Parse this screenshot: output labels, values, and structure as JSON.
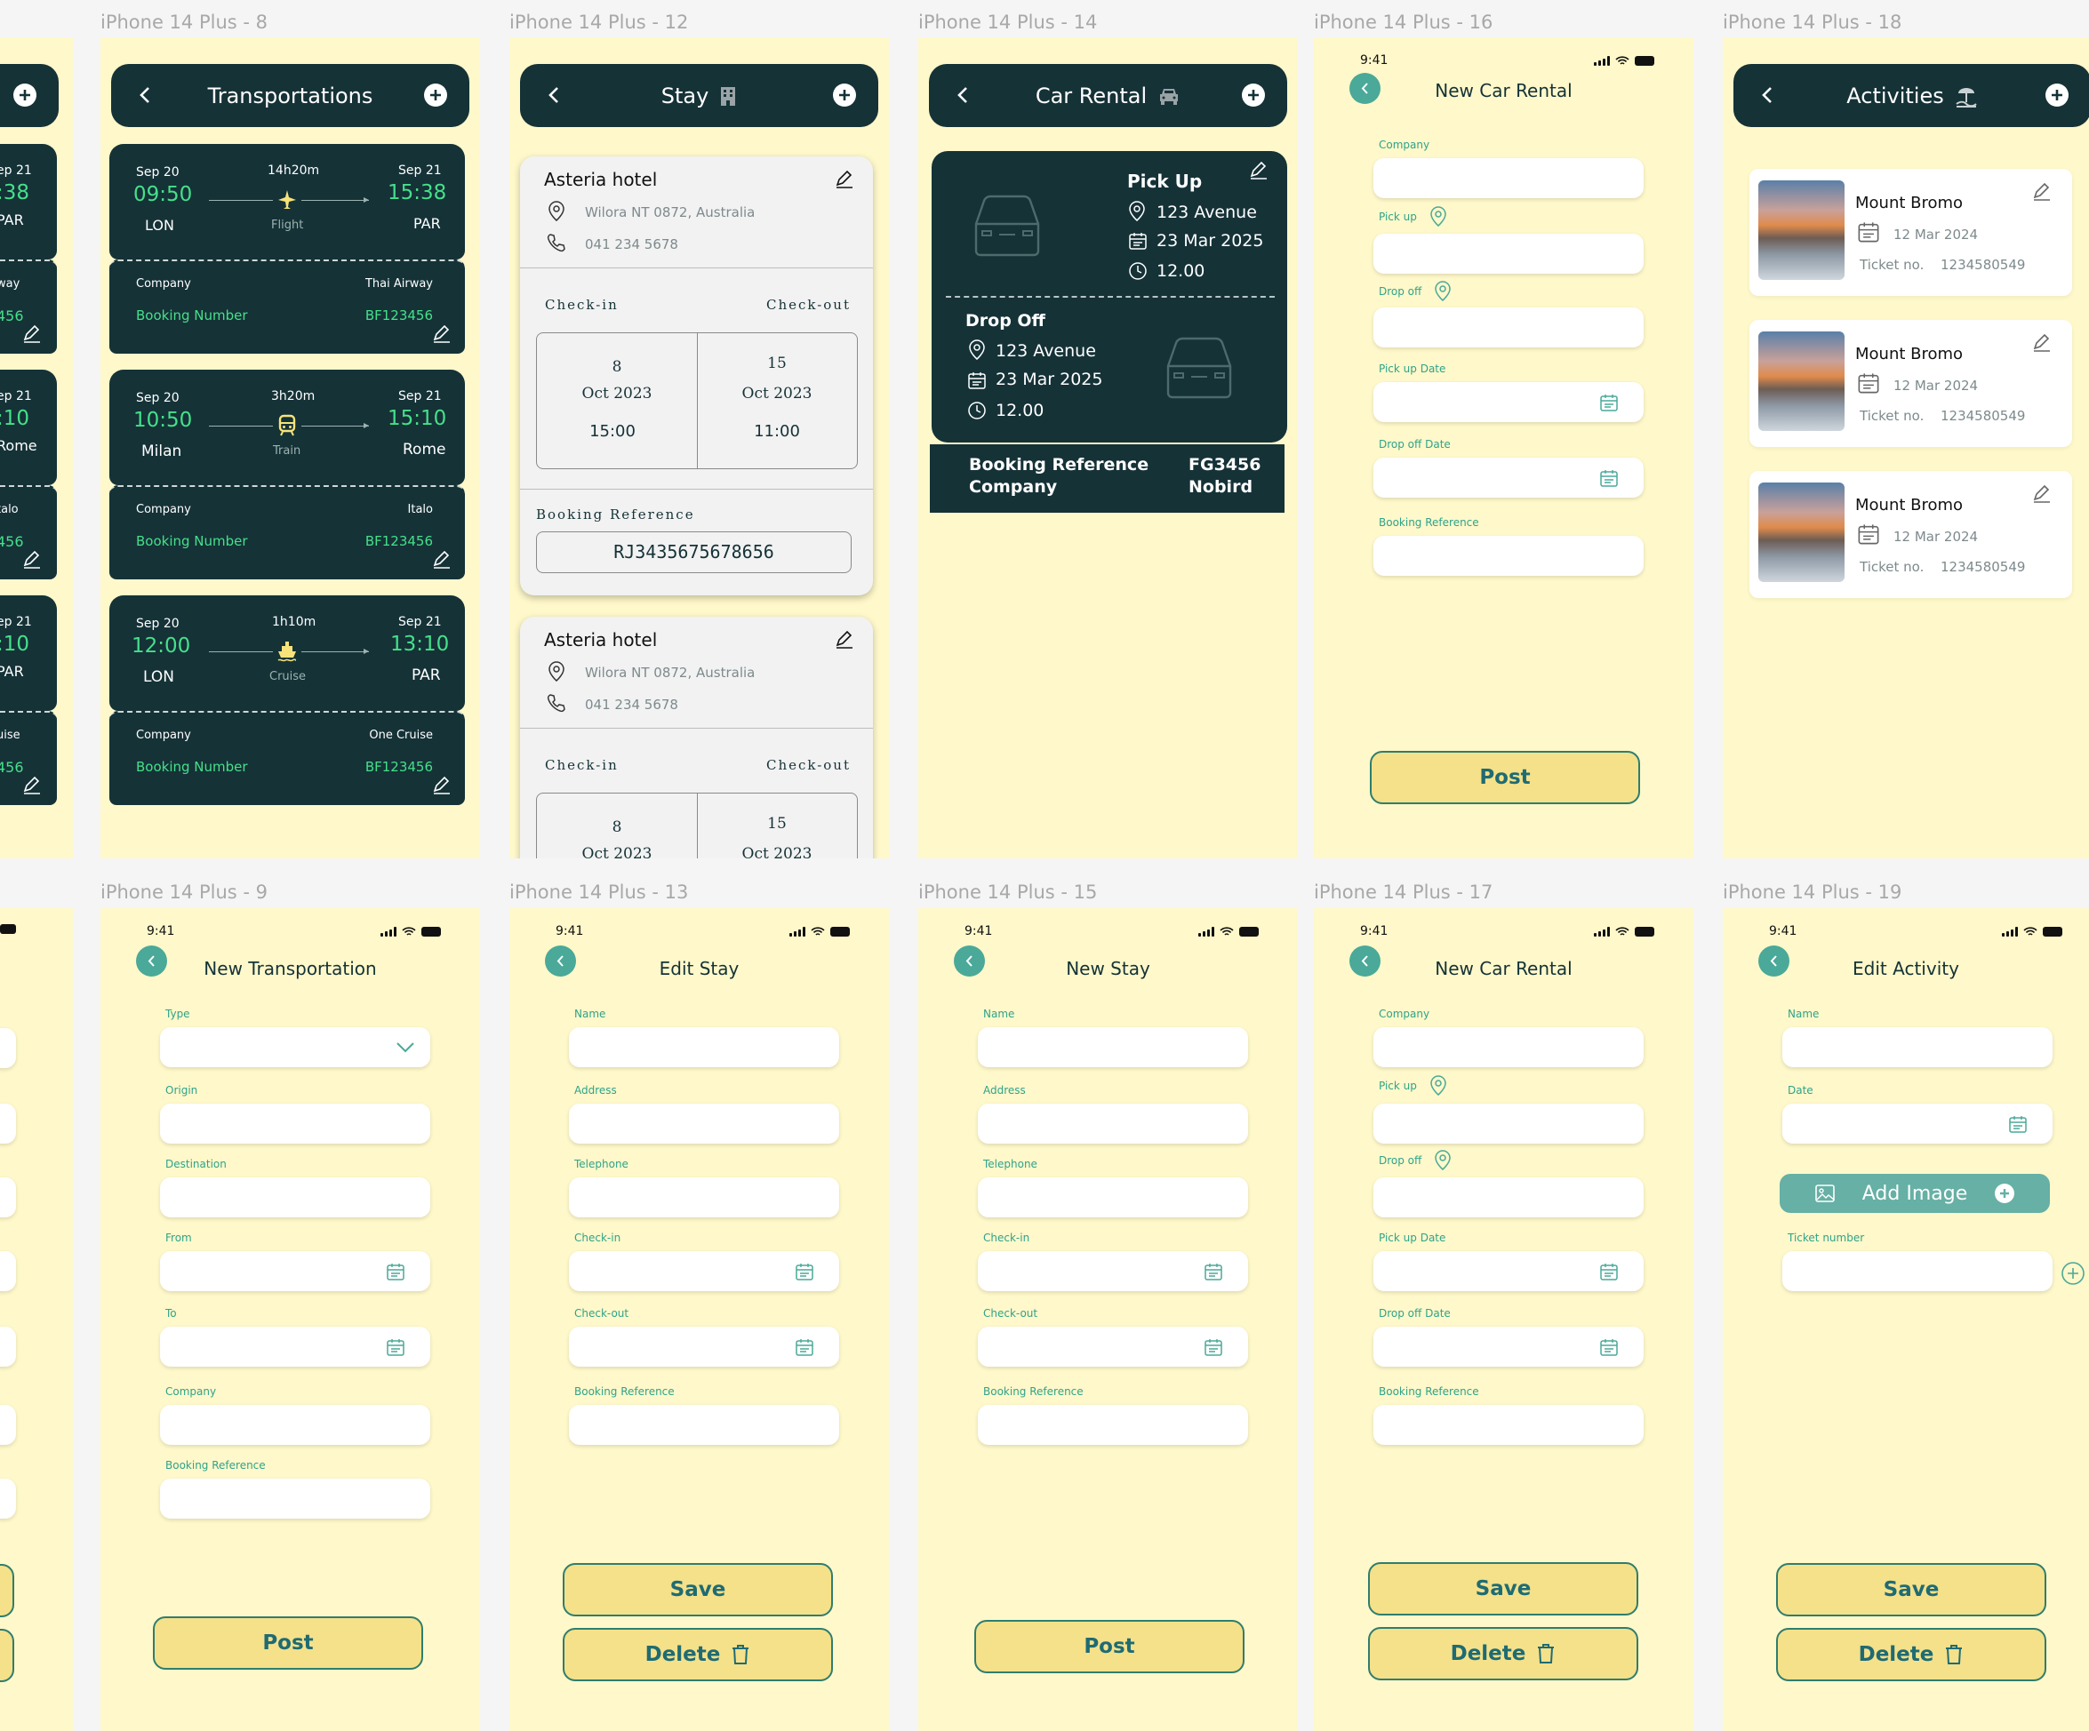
{
  "frames": {
    "f8": {
      "label": "iPhone 14 Plus - 8",
      "header": "Transportations"
    },
    "f9": {
      "label": "iPhone 14 Plus - 9",
      "title": "New Transportation"
    },
    "f12": {
      "label": "iPhone 14 Plus - 12",
      "header": "Stay"
    },
    "f13": {
      "label": "iPhone 14 Plus - 13",
      "title": "Edit Stay"
    },
    "f14": {
      "label": "iPhone 14 Plus - 14",
      "header": "Car Rental"
    },
    "f15": {
      "label": "iPhone 14 Plus - 15",
      "title": "New Stay"
    },
    "f16": {
      "label": "iPhone 14 Plus - 16",
      "title": "New Car Rental"
    },
    "f17": {
      "label": "iPhone 14 Plus - 17",
      "title": "New Car Rental"
    },
    "f18": {
      "label": "iPhone 14 Plus - 18",
      "header": "Activities"
    },
    "f19": {
      "label": "iPhone 14 Plus - 19",
      "title": "Edit Activity"
    }
  },
  "status_time": "9:41",
  "transport": [
    {
      "dep_date": "Sep 20",
      "duration": "14h20m",
      "arr_date": "Sep 21",
      "dep_time": "09:50",
      "arr_time": "15:38",
      "origin": "LON",
      "mode": "Flight",
      "dest": "PAR",
      "company_label": "Company",
      "company": "Thai Airway",
      "booking_label": "Booking Number",
      "booking": "BF123456"
    },
    {
      "dep_date": "Sep 20",
      "duration": "3h20m",
      "arr_date": "Sep 21",
      "dep_time": "10:50",
      "arr_time": "15:10",
      "origin": "Milan",
      "mode": "Train",
      "dest": "Rome",
      "company_label": "Company",
      "company": "Italo",
      "booking_label": "Booking Number",
      "booking": "BF123456"
    },
    {
      "dep_date": "Sep 20",
      "duration": "1h10m",
      "arr_date": "Sep 21",
      "dep_time": "12:00",
      "arr_time": "13:10",
      "origin": "LON",
      "mode": "Cruise",
      "dest": "PAR",
      "company_label": "Company",
      "company": "One Cruise",
      "booking_label": "Booking Number",
      "booking": "BF123456"
    }
  ],
  "partial_left": [
    {
      "arr_date": "ep 21",
      "arr_time": ":38",
      "dest": "PAR",
      "company": "way",
      "booking": "456"
    },
    {
      "arr_date": "ep 21",
      "arr_time": ":10",
      "dest": "Rome",
      "company": "talo",
      "booking": "456"
    },
    {
      "arr_date": "ep 21",
      "arr_time": ":10",
      "dest": "PAR",
      "company": "uise",
      "booking": "456"
    }
  ],
  "stay": {
    "name": "Asteria hotel",
    "address": "Wilora NT 0872, Australia",
    "phone": "041 234 5678",
    "checkin_label": "Check-in",
    "checkout_label": "Check-out",
    "checkin_day": "8",
    "checkin_month": "Oct 2023",
    "checkin_time": "15:00",
    "checkout_day": "15",
    "checkout_month": "Oct 2023",
    "checkout_time": "11:00",
    "booking_label": "Booking Reference",
    "booking": "RJ3435675678656"
  },
  "car": {
    "pickup_label": "Pick Up",
    "pickup_addr": "123 Avenue",
    "pickup_date": "23 Mar 2025",
    "pickup_time": "12.00",
    "dropoff_label": "Drop Off",
    "dropoff_addr": "123 Avenue",
    "dropoff_date": "23 Mar 2025",
    "dropoff_time": "12.00",
    "ref_label": "Booking Reference",
    "ref": "FG3456",
    "company_label": "Company",
    "company": "Nobird"
  },
  "activities": [
    {
      "name": "Mount Bromo",
      "date": "12 Mar 2024",
      "ticket_label": "Ticket no.",
      "ticket": "1234580549"
    },
    {
      "name": "Mount Bromo",
      "date": "12 Mar 2024",
      "ticket_label": "Ticket no.",
      "ticket": "1234580549"
    },
    {
      "name": "Mount Bromo",
      "date": "12 Mar 2024",
      "ticket_label": "Ticket no.",
      "ticket": "1234580549"
    }
  ],
  "fields": {
    "type": "Type",
    "origin": "Origin",
    "destination": "Destination",
    "from": "From",
    "to": "To",
    "company": "Company",
    "booking_reference": "Booking Reference",
    "name": "Name",
    "address": "Address",
    "telephone": "Telephone",
    "checkin": "Check-in",
    "checkout": "Check-out",
    "pickup": "Pick up",
    "dropoff": "Drop off",
    "pickup_date": "Pick up Date",
    "dropoff_date": "Drop off Date",
    "date": "Date",
    "ticket_number": "Ticket number"
  },
  "buttons": {
    "post": "Post",
    "save": "Save",
    "delete": "Delete",
    "add_image": "Add Image"
  },
  "colors": {
    "frame_bg": "#fef8ca",
    "dark": "#153237",
    "accent": "#4aa999",
    "time_green": "#45e08a",
    "button": "#f4e18a"
  }
}
